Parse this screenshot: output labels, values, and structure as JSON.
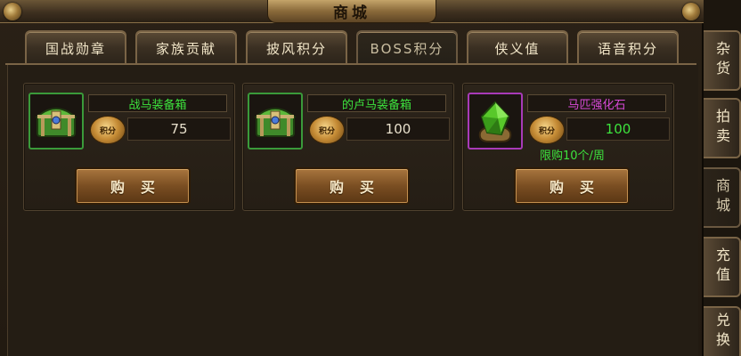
{
  "window": {
    "title": "商城"
  },
  "tabs": [
    {
      "label": "国战勋章"
    },
    {
      "label": "家族贡献"
    },
    {
      "label": "披风积分"
    },
    {
      "label": "BOSS积分",
      "active": true
    },
    {
      "label": "侠义值"
    },
    {
      "label": "语音积分"
    }
  ],
  "side_tabs": [
    {
      "label": "杂货"
    },
    {
      "label": "拍卖"
    },
    {
      "label": "商城",
      "active": true
    },
    {
      "label": "充值"
    },
    {
      "label": "兑换"
    }
  ],
  "items": [
    {
      "name": "战马装备箱",
      "currency_label": "积分",
      "price": "75",
      "icon": "green-treasure-chest-icon",
      "buy_label": "购买",
      "limit": ""
    },
    {
      "name": "的卢马装备箱",
      "currency_label": "积分",
      "price": "100",
      "icon": "green-treasure-chest-icon",
      "buy_label": "购买",
      "limit": ""
    },
    {
      "name": "马匹强化石",
      "currency_label": "积分",
      "price": "100",
      "icon": "green-gem-stone-icon",
      "buy_label": "购买",
      "limit": "限购10个/周"
    }
  ],
  "colors": {
    "item_name_green": "#3de23d",
    "item_name_purple": "#d84ad8",
    "frame_green": "#3a9a3a",
    "frame_purple": "#a83ab8"
  }
}
